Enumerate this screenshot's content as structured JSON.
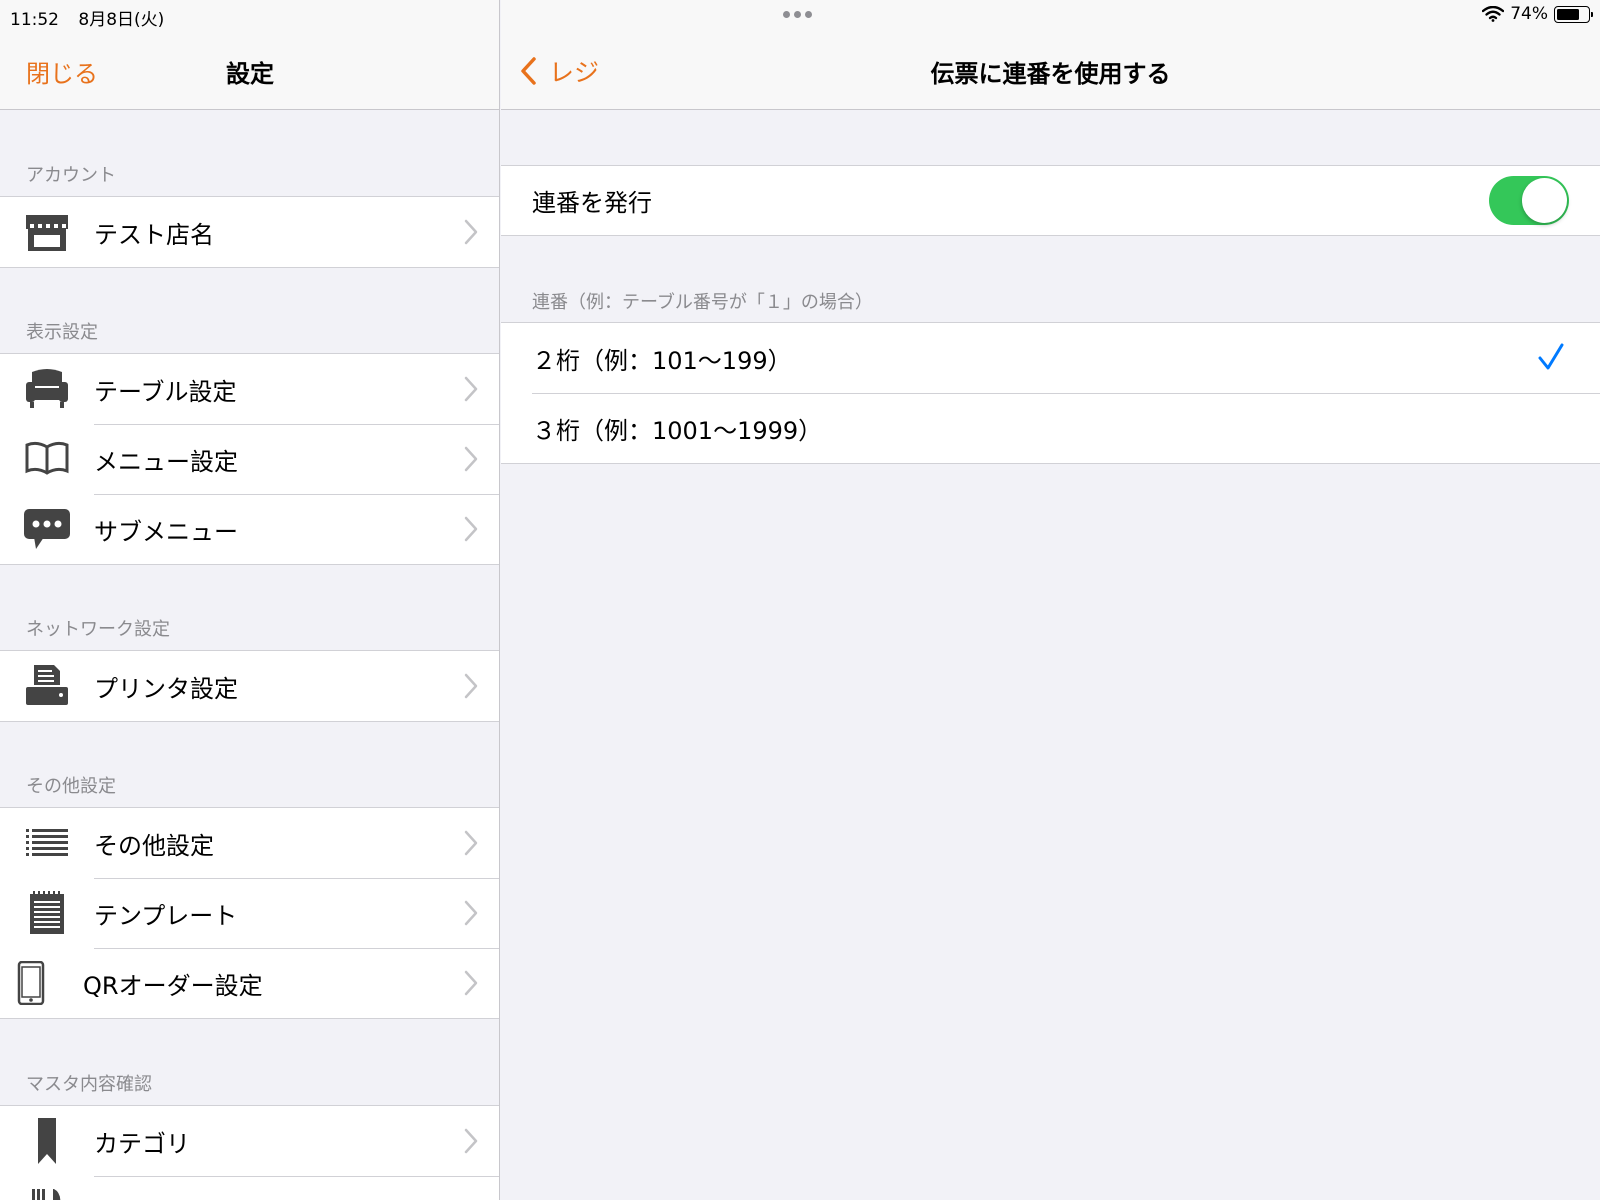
{
  "status_bar": {
    "time": "11:52",
    "date": "8月8日(火)",
    "battery_text": "74%",
    "battery_level": 0.74
  },
  "sidebar": {
    "close_label": "閉じる",
    "title": "設定",
    "sections": [
      {
        "header": "アカウント",
        "items": [
          {
            "label": "テスト店名",
            "icon": "storefront-icon"
          }
        ]
      },
      {
        "header": "表示設定",
        "items": [
          {
            "label": "テーブル設定",
            "icon": "armchair-icon"
          },
          {
            "label": "メニュー設定",
            "icon": "open-book-icon"
          },
          {
            "label": "サブメニュー",
            "icon": "speech-bubble-icon"
          }
        ]
      },
      {
        "header": "ネットワーク設定",
        "items": [
          {
            "label": "プリンタ設定",
            "icon": "printer-icon"
          }
        ]
      },
      {
        "header": "その他設定",
        "items": [
          {
            "label": "その他設定",
            "icon": "list-icon"
          },
          {
            "label": "テンプレート",
            "icon": "notepad-icon"
          },
          {
            "label": "QRオーダー設定",
            "icon": "smartphone-icon"
          }
        ]
      },
      {
        "header": "マスタ内容確認",
        "items": [
          {
            "label": "カテゴリ",
            "icon": "bookmark-icon"
          }
        ]
      }
    ]
  },
  "detail": {
    "back_label": "レジ",
    "title": "伝票に連番を使用する",
    "toggle_row": {
      "label": "連番を発行",
      "enabled": true
    },
    "options_header": "連番（例：テーブル番号が「１」の場合）",
    "options": [
      {
        "label": "２桁（例：101～199）",
        "selected": true
      },
      {
        "label": "３桁（例：1001～1999）",
        "selected": false
      }
    ]
  },
  "colors": {
    "accent": "#e8721c",
    "toggle_on": "#34c759",
    "checkmark": "#007aff"
  }
}
